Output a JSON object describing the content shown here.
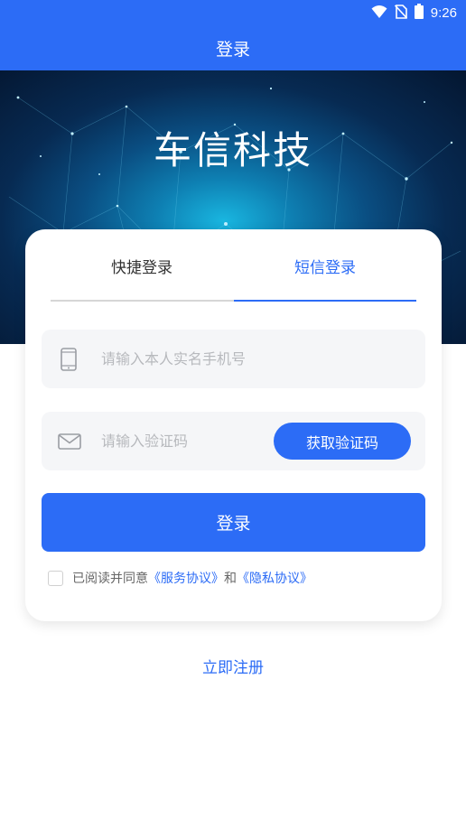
{
  "status_bar": {
    "time": "9:26",
    "icons": [
      "wifi-icon",
      "no-sim-icon",
      "battery-icon"
    ]
  },
  "header": {
    "title": "登录"
  },
  "hero": {
    "title": "车信科技"
  },
  "tabs": [
    {
      "label": "快捷登录",
      "active": false
    },
    {
      "label": "短信登录",
      "active": true
    }
  ],
  "form": {
    "phone": {
      "placeholder": "请输入本人实名手机号",
      "value": "",
      "icon": "phone-icon"
    },
    "code": {
      "placeholder": "请输入验证码",
      "value": "",
      "icon": "mail-icon"
    },
    "get_code_label": "获取验证码",
    "login_label": "登录"
  },
  "agreement": {
    "checked": false,
    "prefix": "已阅读并同意",
    "service_link": "《服务协议》",
    "and": "和",
    "privacy_link": "《隐私协议》"
  },
  "register_label": "立即注册",
  "colors": {
    "primary": "#2c6cf6",
    "placeholder": "#b7b9bd",
    "field_bg": "#f5f6f8"
  }
}
